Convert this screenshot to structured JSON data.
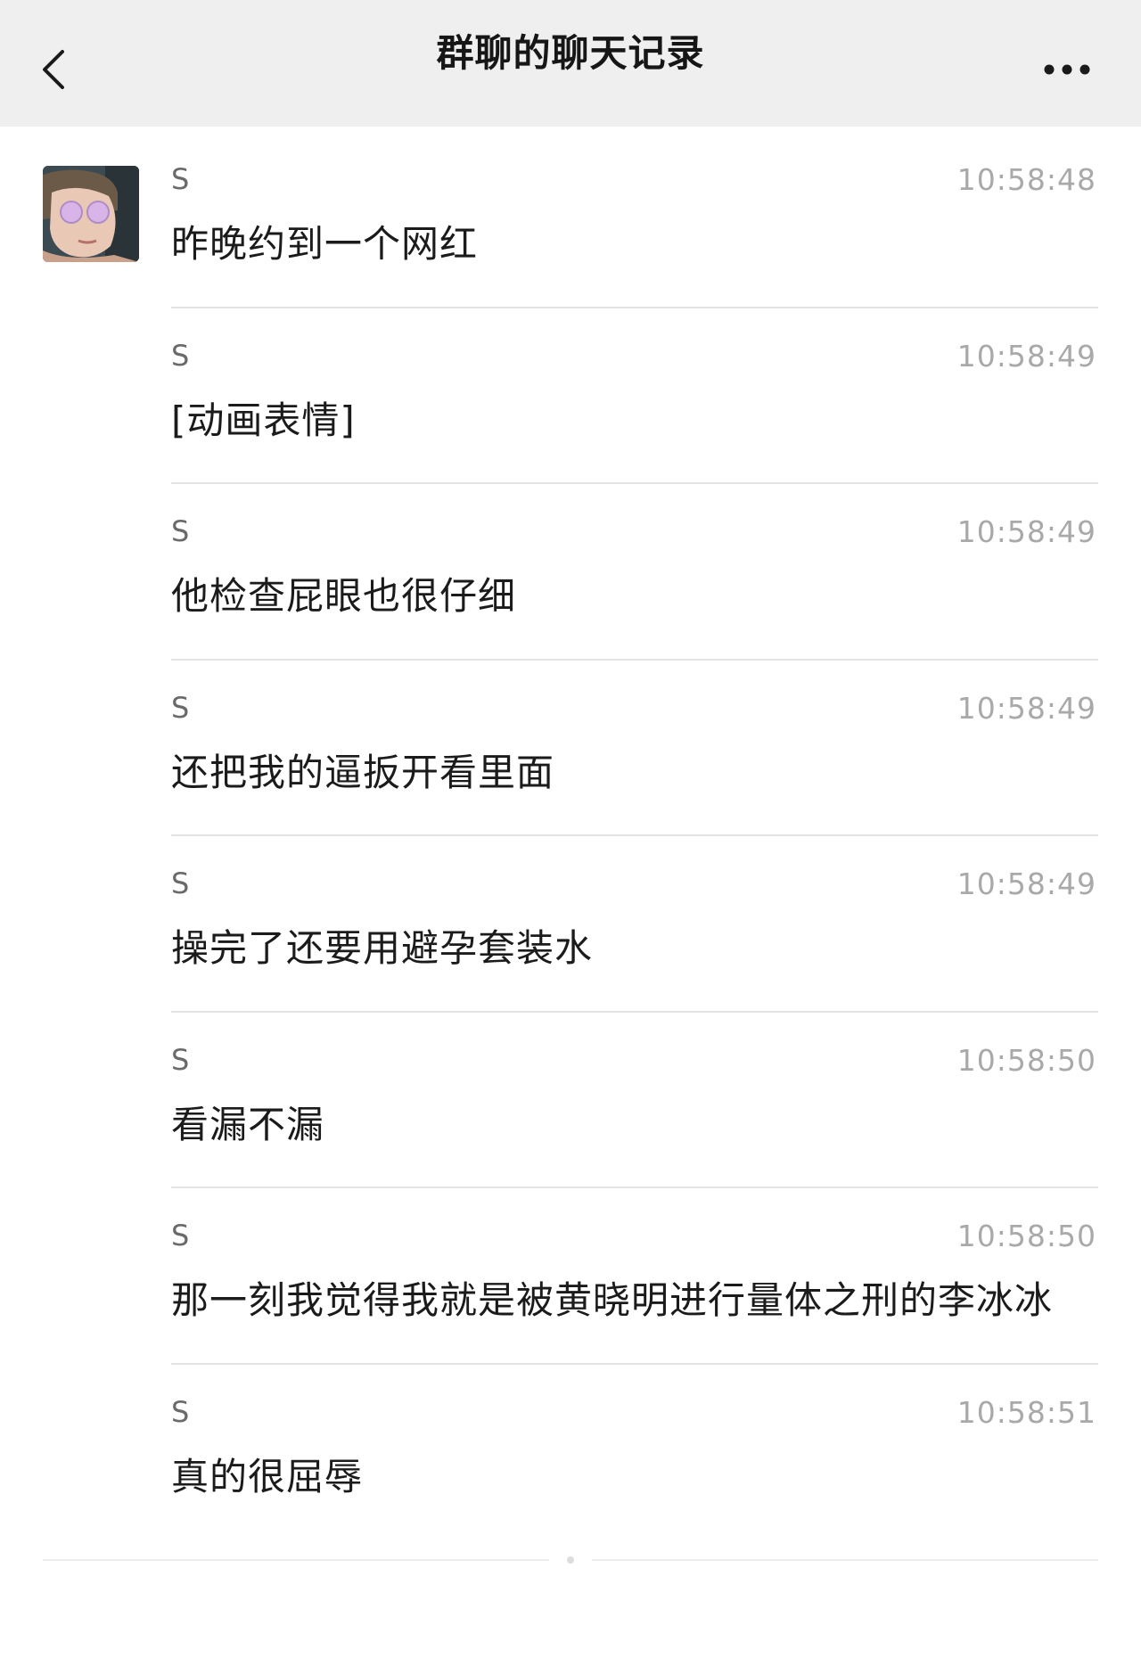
{
  "navbar": {
    "title": "群聊的聊天记录",
    "back_icon": "chevron-left-icon",
    "more_icon": "more-horizontal-icon"
  },
  "avatar": {
    "icon": "user-avatar-photo"
  },
  "messages": [
    {
      "sender": "S",
      "time": "10:58:48",
      "text": "昨晚约到一个网红"
    },
    {
      "sender": "S",
      "time": "10:58:49",
      "text": "[动画表情]"
    },
    {
      "sender": "S",
      "time": "10:58:49",
      "text": "他检查屁眼也很仔细"
    },
    {
      "sender": "S",
      "time": "10:58:49",
      "text": "还把我的逼扳开看里面"
    },
    {
      "sender": "S",
      "time": "10:58:49",
      "text": "操完了还要用避孕套装水"
    },
    {
      "sender": "S",
      "time": "10:58:50",
      "text": "看漏不漏"
    },
    {
      "sender": "S",
      "time": "10:58:50",
      "text": "那一刻我觉得我就是被黄晓明进行量体之刑的李冰冰"
    },
    {
      "sender": "S",
      "time": "10:58:51",
      "text": "真的很屈辱"
    }
  ],
  "colors": {
    "navbar_bg": "#efefef",
    "divider": "#e3e3e3",
    "time_text": "#a9a9a9",
    "sender_text": "#6a6a6a"
  }
}
